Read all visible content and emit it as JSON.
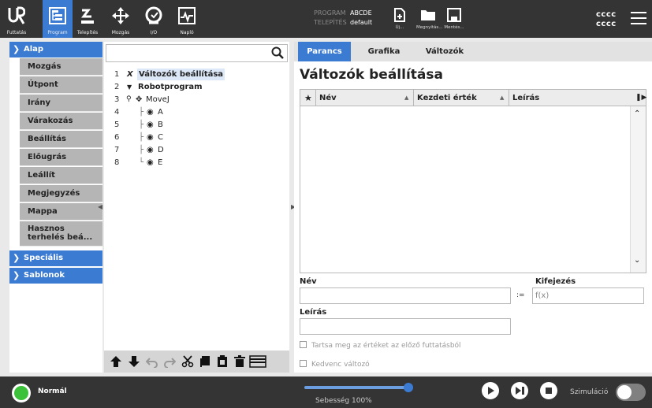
{
  "topbar": {
    "nav": [
      {
        "label": "Futtatás",
        "icon": "ur-logo-icon"
      },
      {
        "label": "Program",
        "icon": "program-tree-icon"
      },
      {
        "label": "Telepítés",
        "icon": "robot-arm-icon"
      },
      {
        "label": "Mozgás",
        "icon": "move-arrows-icon"
      },
      {
        "label": "I/O",
        "icon": "io-icon"
      },
      {
        "label": "Napló",
        "icon": "log-chart-icon"
      }
    ],
    "program_key": "PROGRAM",
    "program_value": "ABCDE",
    "installation_key": "TELEPÍTÉS",
    "installation_value": "default",
    "files": [
      {
        "label": "Új...",
        "icon": "new-file-icon"
      },
      {
        "label": "Megnyitás...",
        "icon": "open-folder-icon"
      },
      {
        "label": "Mentés...",
        "icon": "save-icon"
      }
    ],
    "user_line1": "cccc",
    "user_line2": "cccc"
  },
  "left": {
    "groups": [
      "Alap",
      "Speciális",
      "Sablonok"
    ],
    "commands": [
      "Mozgás",
      "Útpont",
      "Irány",
      "Várakozás",
      "Beállítás",
      "Előugrás",
      "Leállít",
      "Megjegyzés",
      "Mappa",
      "Hasznos terhelés beá..."
    ]
  },
  "tree": {
    "search_value": "",
    "rows": [
      {
        "num": "1",
        "text": "Változók beállítása"
      },
      {
        "num": "2",
        "text": "Robotprogram"
      },
      {
        "num": "3",
        "text": "MoveJ"
      },
      {
        "num": "4",
        "text": "A"
      },
      {
        "num": "5",
        "text": "B"
      },
      {
        "num": "6",
        "text": "C"
      },
      {
        "num": "7",
        "text": "D"
      },
      {
        "num": "8",
        "text": "E"
      }
    ]
  },
  "right": {
    "tabs": [
      "Parancs",
      "Grafika",
      "Változók"
    ],
    "title": "Változók beállítása",
    "columns": [
      "Név",
      "Kezdeti érték",
      "Leírás"
    ],
    "name_label": "Név",
    "name_value": "",
    "expr_label": "Kifejezés",
    "expr_placeholder": "f(x)",
    "assign_symbol": ":=",
    "desc_label": "Leírás",
    "desc_value": "",
    "keep_value_label": "Tartsa meg az értéket az előző futtatásból",
    "favorite_label": "Kedvenc változó"
  },
  "bottombar": {
    "status": "Normál",
    "speed_label": "Sebesség 100%",
    "speed_percent": 100,
    "simulation_label": "Szimuláció",
    "simulation_on": false
  },
  "colors": {
    "accent": "#3b7bd1",
    "topbar": "#343434",
    "status_ok": "#3cc13b"
  }
}
